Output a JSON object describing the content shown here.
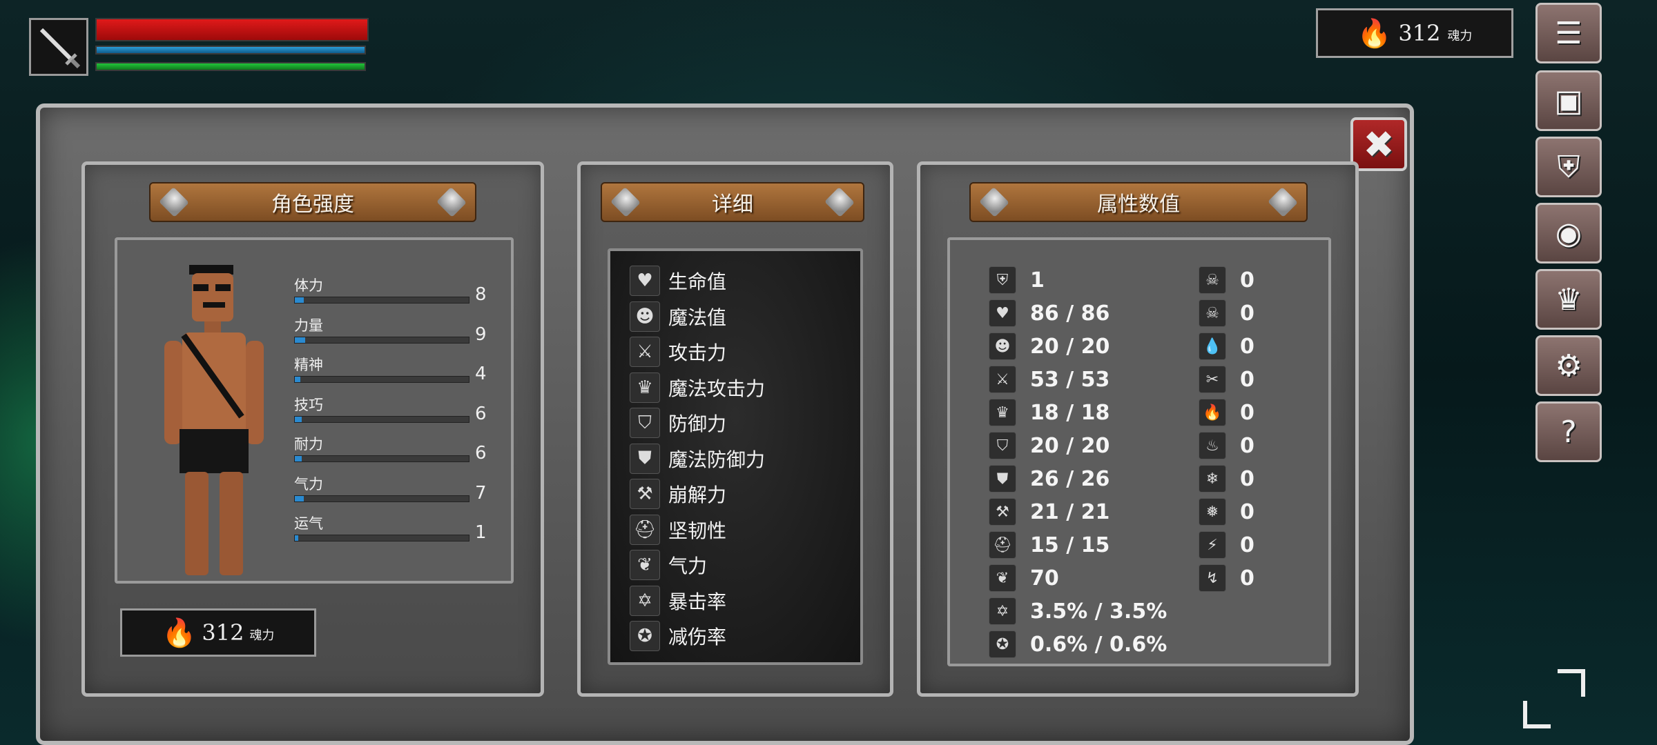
{
  "hud": {
    "soul_value": "312",
    "soul_unit": "魂力"
  },
  "side_buttons": [
    {
      "name": "menu-list-button",
      "icon": "☰"
    },
    {
      "name": "inventory-button",
      "icon": "▣"
    },
    {
      "name": "equipment-helmet-button",
      "icon": "⛨"
    },
    {
      "name": "skills-emblem-button",
      "icon": "◉"
    },
    {
      "name": "crown-button",
      "icon": "♛"
    },
    {
      "name": "settings-button",
      "icon": "⚙"
    },
    {
      "name": "help-button",
      "icon": "?"
    }
  ],
  "panels": {
    "character": {
      "title": "角色强度",
      "stats": [
        {
          "label": "体力",
          "value": "8",
          "fill": 0.05
        },
        {
          "label": "力量",
          "value": "9",
          "fill": 0.06
        },
        {
          "label": "精神",
          "value": "4",
          "fill": 0.03
        },
        {
          "label": "技巧",
          "value": "6",
          "fill": 0.04
        },
        {
          "label": "耐力",
          "value": "6",
          "fill": 0.04
        },
        {
          "label": "气力",
          "value": "7",
          "fill": 0.05
        },
        {
          "label": "运气",
          "value": "1",
          "fill": 0.01
        }
      ],
      "soul_value": "312",
      "soul_unit": "魂力"
    },
    "detail": {
      "title": "详细",
      "rows": [
        {
          "icon": "heart-icon",
          "glyph": "♥",
          "label": "生命值"
        },
        {
          "icon": "head-icon",
          "glyph": "☻",
          "label": "魔法值"
        },
        {
          "icon": "sword-icon",
          "glyph": "⚔",
          "label": "攻击力"
        },
        {
          "icon": "magic-crown-icon",
          "glyph": "♛",
          "label": "魔法攻击力"
        },
        {
          "icon": "shield-icon",
          "glyph": "⛉",
          "label": "防御力"
        },
        {
          "icon": "magic-shield-icon",
          "glyph": "⛊",
          "label": "魔法防御力"
        },
        {
          "icon": "break-hammer-icon",
          "glyph": "⚒",
          "label": "崩解力"
        },
        {
          "icon": "helmet-icon",
          "glyph": "⛑",
          "label": "坚韧性"
        },
        {
          "icon": "lungs-icon",
          "glyph": "❦",
          "label": "气力"
        },
        {
          "icon": "crit-star-icon",
          "glyph": "✡",
          "label": "暴击率"
        },
        {
          "icon": "damage-reduce-icon",
          "glyph": "✪",
          "label": "减伤率"
        }
      ]
    },
    "attributes": {
      "title": "属性数值",
      "left": [
        {
          "icon": "level-helmet-icon",
          "glyph": "⛨",
          "value": "1"
        },
        {
          "icon": "heart-icon",
          "glyph": "♥",
          "value": "86 / 86"
        },
        {
          "icon": "head-icon",
          "glyph": "☻",
          "value": "20 / 20"
        },
        {
          "icon": "sword-icon",
          "glyph": "⚔",
          "value": "53 / 53"
        },
        {
          "icon": "magic-crown-icon",
          "glyph": "♛",
          "value": "18 / 18"
        },
        {
          "icon": "shield-icon",
          "glyph": "⛉",
          "value": "20 / 20"
        },
        {
          "icon": "magic-shield-icon",
          "glyph": "⛊",
          "value": "26 / 26"
        },
        {
          "icon": "break-hammer-icon",
          "glyph": "⚒",
          "value": "21 / 21"
        },
        {
          "icon": "helmet-icon",
          "glyph": "⛑",
          "value": "15 / 15"
        },
        {
          "icon": "lungs-icon",
          "glyph": "❦",
          "value": "70"
        },
        {
          "icon": "crit-star-icon",
          "glyph": "✡",
          "value": "3.5% / 3.5%"
        },
        {
          "icon": "damage-reduce-icon",
          "glyph": "✪",
          "value": "0.6% / 0.6%"
        }
      ],
      "right": [
        {
          "icon": "poison-skull-icon",
          "glyph": "☠",
          "value": "0"
        },
        {
          "icon": "poison-resist-icon",
          "glyph": "☠",
          "value": "0"
        },
        {
          "icon": "water-drop-icon",
          "glyph": "💧",
          "value": "0"
        },
        {
          "icon": "bleed-resist-icon",
          "glyph": "✂",
          "value": "0"
        },
        {
          "icon": "fire-icon",
          "glyph": "🔥",
          "value": "0"
        },
        {
          "icon": "fire-resist-icon",
          "glyph": "♨",
          "value": "0"
        },
        {
          "icon": "frost-icon",
          "glyph": "❄",
          "value": "0"
        },
        {
          "icon": "frost-resist-icon",
          "glyph": "❅",
          "value": "0"
        },
        {
          "icon": "lightning-icon",
          "glyph": "⚡",
          "value": "0"
        },
        {
          "icon": "lightning-resist-icon",
          "glyph": "↯",
          "value": "0"
        }
      ]
    }
  },
  "close_icon": "✖"
}
